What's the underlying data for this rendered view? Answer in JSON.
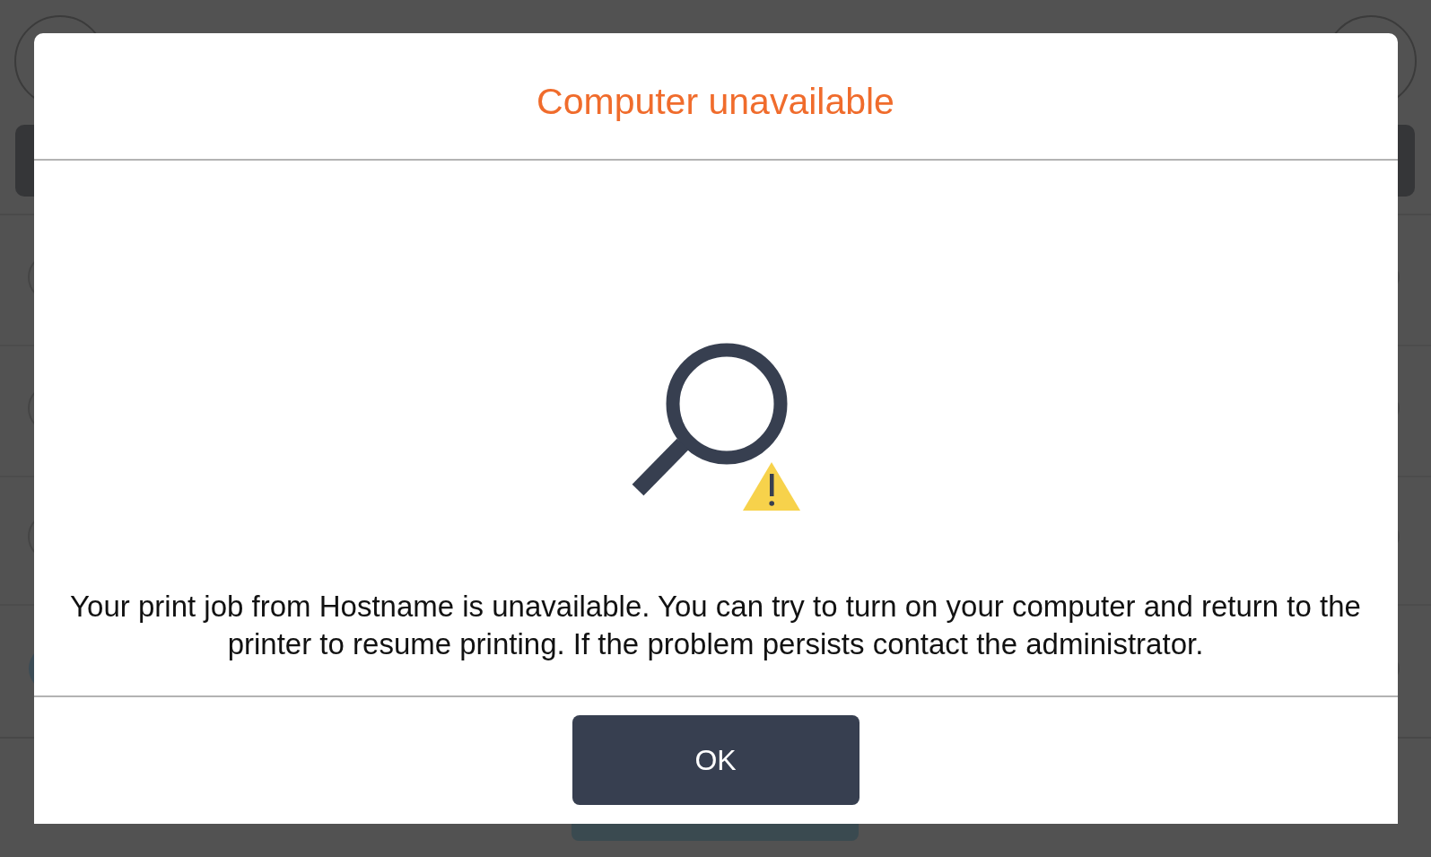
{
  "dialog": {
    "title": "Computer unavailable",
    "message": "Your print job from Hostname is unavailable. You can try to turn on your computer and return to the printer to resume printing. If the problem persists contact the administrator.",
    "buttons": [
      "OK"
    ]
  }
}
